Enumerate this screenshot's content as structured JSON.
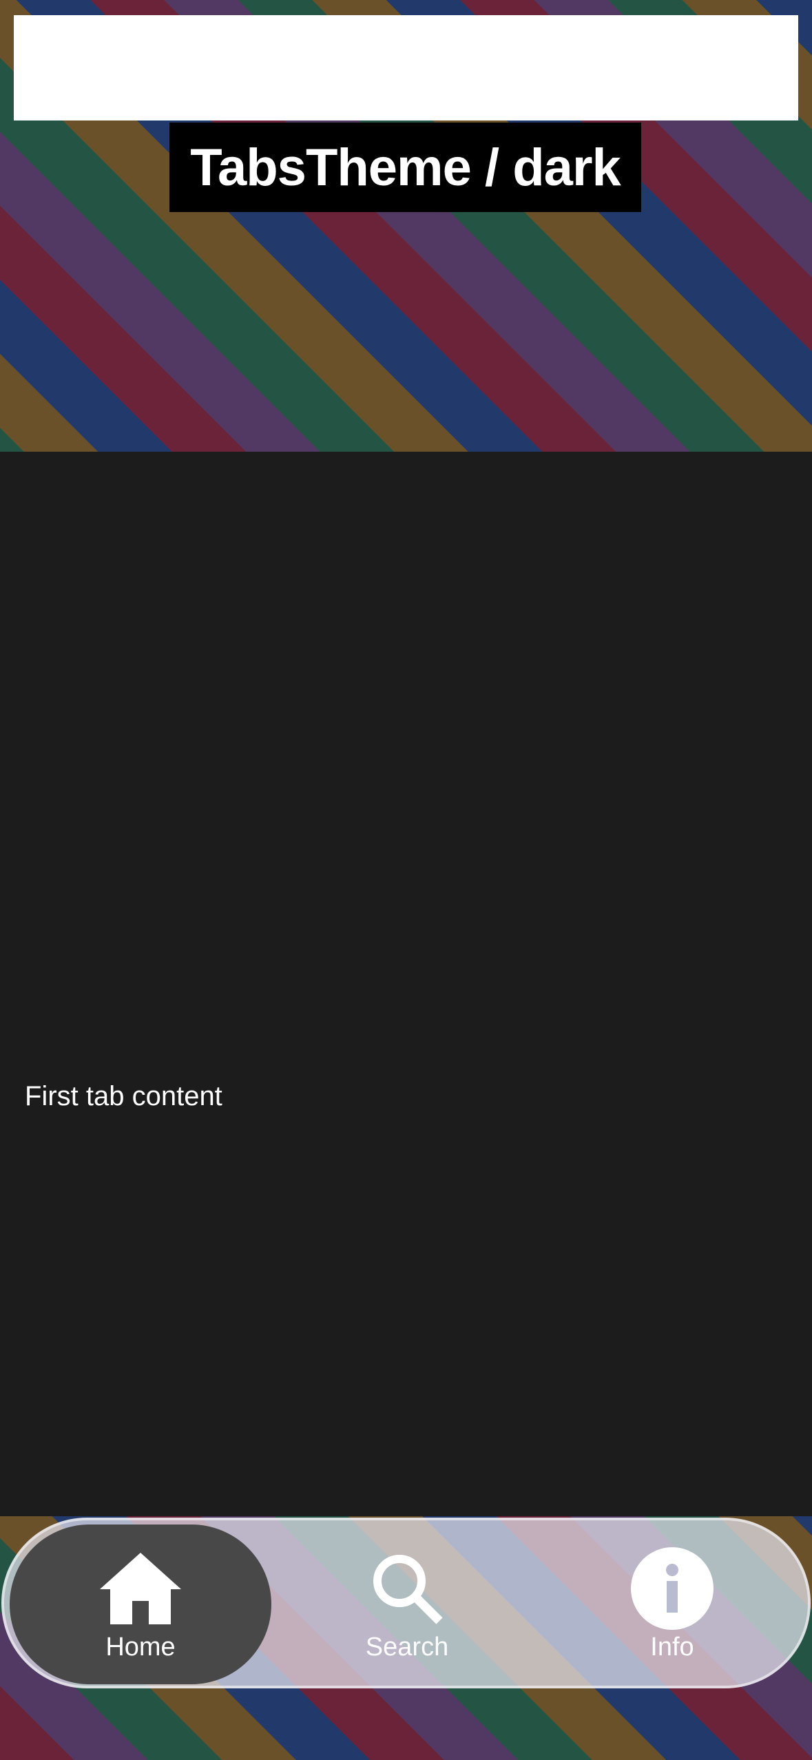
{
  "header": {
    "title": "TabsTheme / dark"
  },
  "main": {
    "content_text": "First tab content"
  },
  "tabs": [
    {
      "label": "Home",
      "icon": "home-icon",
      "selected": true
    },
    {
      "label": "Search",
      "icon": "search-icon",
      "selected": false
    },
    {
      "label": "Info",
      "icon": "info-icon",
      "selected": false
    }
  ],
  "colors": {
    "content_background": "#1c1c1c",
    "selected_tab_background": "#484848",
    "stripes": [
      "#6a2338",
      "#523963",
      "#235444",
      "#6a5129",
      "#213a6b"
    ]
  }
}
